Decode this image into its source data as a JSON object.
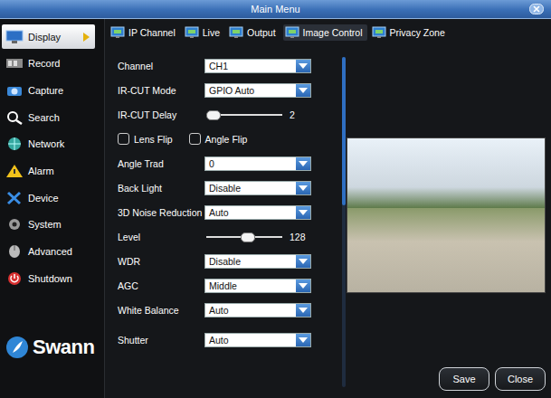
{
  "window": {
    "title": "Main Menu"
  },
  "sidebar": {
    "items": [
      {
        "label": "Display",
        "selected": true
      },
      {
        "label": "Record",
        "selected": false
      },
      {
        "label": "Capture",
        "selected": false
      },
      {
        "label": "Search",
        "selected": false
      },
      {
        "label": "Network",
        "selected": false
      },
      {
        "label": "Alarm",
        "selected": false
      },
      {
        "label": "Device",
        "selected": false
      },
      {
        "label": "System",
        "selected": false
      },
      {
        "label": "Advanced",
        "selected": false
      },
      {
        "label": "Shutdown",
        "selected": false
      }
    ]
  },
  "logo": {
    "text": "Swann"
  },
  "tabs": [
    {
      "label": "IP Channel",
      "selected": false
    },
    {
      "label": "Live",
      "selected": false
    },
    {
      "label": "Output",
      "selected": false
    },
    {
      "label": "Image Control",
      "selected": true
    },
    {
      "label": "Privacy Zone",
      "selected": false
    }
  ],
  "settings": [
    {
      "kind": "dropdown",
      "label": "Channel",
      "value": "CH1"
    },
    {
      "kind": "dropdown",
      "label": "IR-CUT Mode",
      "value": "GPIO Auto"
    },
    {
      "kind": "slider",
      "label": "IR-CUT Delay",
      "level": 0.05,
      "reading": "2"
    },
    {
      "kind": "checkboxes",
      "options": [
        {
          "label": "Lens Flip",
          "checked": false
        },
        {
          "label": "Angle Flip",
          "checked": false
        }
      ]
    },
    {
      "kind": "dropdown",
      "label": "Angle Trad",
      "value": "0"
    },
    {
      "kind": "dropdown",
      "label": "Back Light",
      "value": "Disable"
    },
    {
      "kind": "dropdown",
      "label": "3D Noise Reduction",
      "value": "Auto"
    },
    {
      "kind": "slider",
      "label": "Level",
      "level": 0.5,
      "reading": "128"
    },
    {
      "kind": "dropdown",
      "label": "WDR",
      "value": "Disable"
    },
    {
      "kind": "dropdown",
      "label": "AGC",
      "value": "Middle"
    },
    {
      "kind": "dropdown",
      "label": "White Balance",
      "value": "Auto"
    },
    {
      "kind": "dropdown",
      "label": "Shutter",
      "value": "Auto"
    }
  ],
  "scrollbar": {
    "level": 0.45
  },
  "buttons": [
    {
      "label": "Save"
    },
    {
      "label": "Close"
    }
  ]
}
